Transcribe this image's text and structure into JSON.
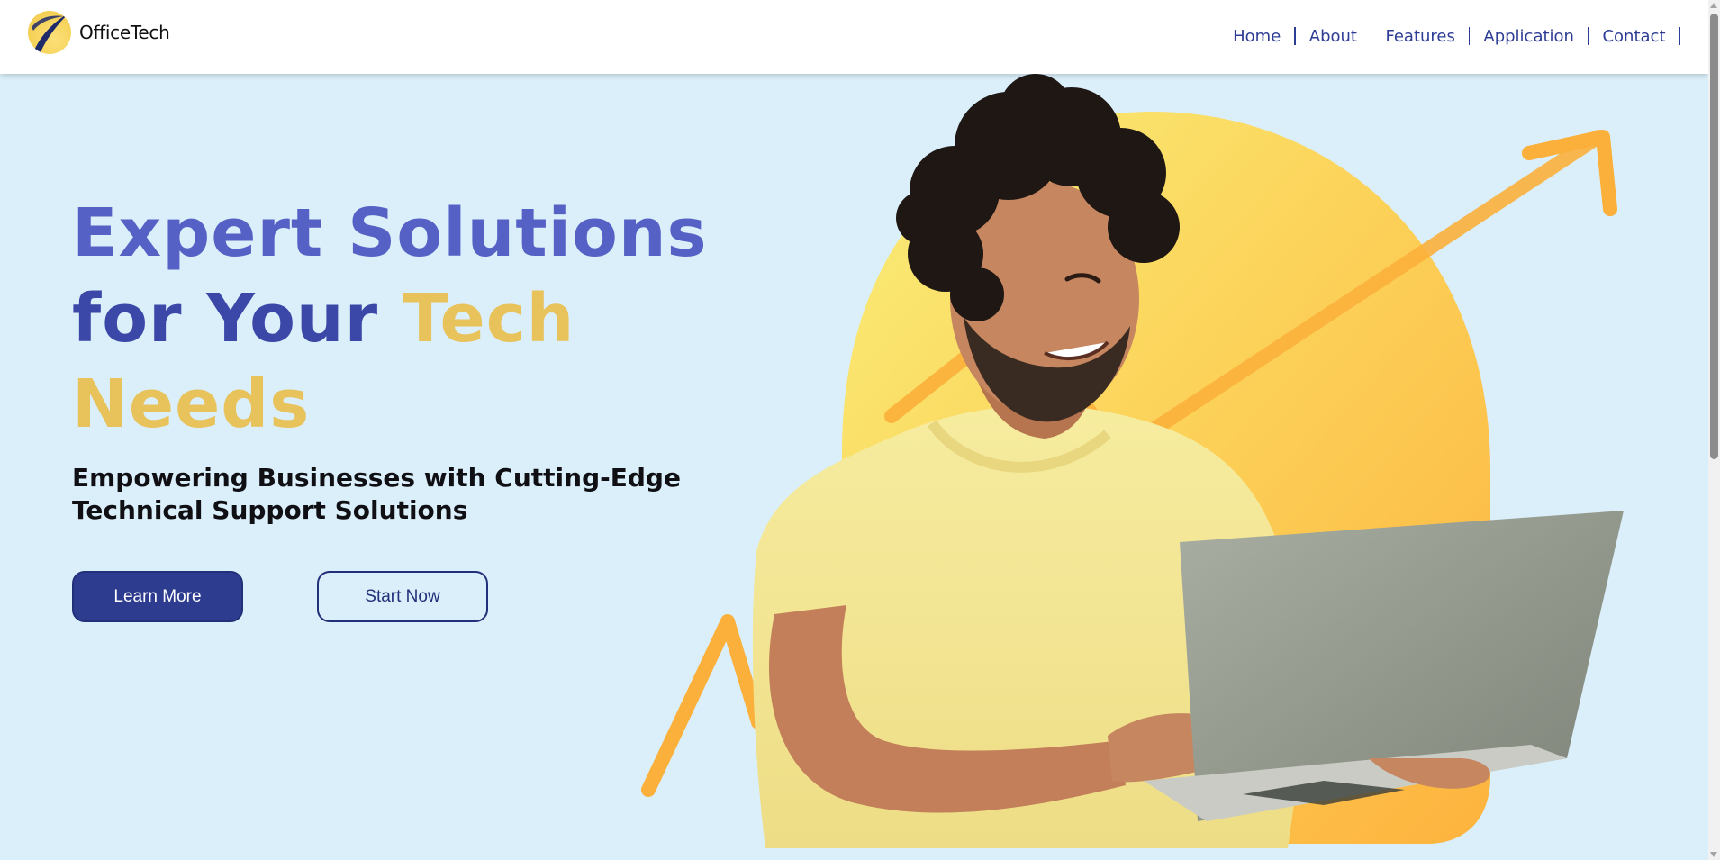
{
  "brand": {
    "name": "OfficeTech",
    "logo_icon": "swoosh-logo-icon"
  },
  "nav": {
    "items": [
      {
        "label": "Home"
      },
      {
        "label": "About"
      },
      {
        "label": "Features"
      },
      {
        "label": "Application"
      },
      {
        "label": "Contact"
      }
    ]
  },
  "hero": {
    "title_line1": "Expert Solutions",
    "title_line2_a": "for Your",
    "title_line2_b": "Tech",
    "title_line3": "Needs",
    "subtitle": "Empowering Businesses with Cutting-Edge Technical Support Solutions",
    "primary_button": "Learn More",
    "secondary_button": "Start Now",
    "image_alt": "man-with-laptop-illustration"
  },
  "colors": {
    "background": "#dbeffa",
    "accent_blue": "#2d3c94",
    "title_blue": "#5561c4",
    "accent_yellow": "#e8c25a",
    "arrow_orange": "#fbb03b"
  }
}
